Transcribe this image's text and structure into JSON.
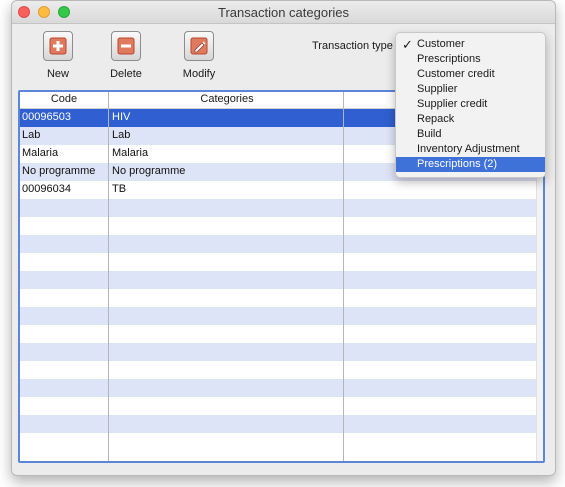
{
  "window": {
    "title": "Transaction categories"
  },
  "toolbar": {
    "new_label": "New",
    "delete_label": "Delete",
    "modify_label": "Modify"
  },
  "filter": {
    "label": "Transaction type",
    "selected": "Customer",
    "options": [
      "Customer",
      "Prescriptions",
      "Customer credit",
      "Supplier",
      "Supplier credit",
      "Repack",
      "Build",
      "Inventory Adjustment",
      "Prescriptions (2)"
    ],
    "highlighted": "Prescriptions (2)"
  },
  "table": {
    "headers": {
      "code": "Code",
      "categories": "Categories"
    },
    "rows": [
      {
        "code": "00096503",
        "category": "HIV"
      },
      {
        "code": "Lab",
        "category": "Lab"
      },
      {
        "code": "Malaria",
        "category": "Malaria"
      },
      {
        "code": "No programme",
        "category": "No programme"
      },
      {
        "code": "00096034",
        "category": "TB"
      }
    ],
    "selected_row": 0
  },
  "colors": {
    "selection": "#2f5fd0",
    "stripe": "#dee4f7",
    "accent_border": "#5b86d9",
    "add_icon": "#d9533c",
    "delete_icon": "#d9533c"
  },
  "icons": {
    "new": "plus-icon",
    "delete": "minus-icon",
    "modify": "pencil-icon",
    "checkmark": "checkmark-icon"
  }
}
